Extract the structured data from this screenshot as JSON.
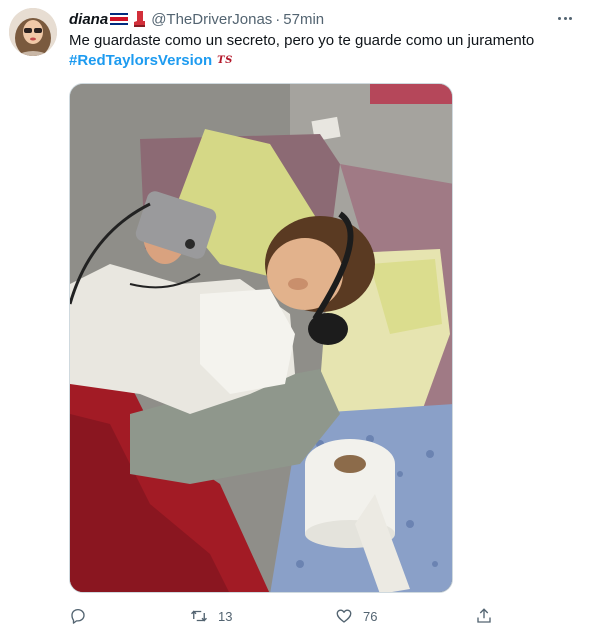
{
  "tweet": {
    "display_name": "diana",
    "handle": "@TheDriverJonas",
    "separator": "·",
    "time": "57min",
    "text": "Me guardaste como un secreto, pero yo te guarde como un juramento",
    "hashtag": "#RedTaylorsVersion",
    "hashtag_emoji_text": "TS"
  },
  "icons": {
    "avatar": "avatar",
    "flag": "costa-rica-flag-icon",
    "boot": "red-boot-icon",
    "more": "more-icon",
    "reply": "reply-icon",
    "retweet": "retweet-icon",
    "like": "heart-icon",
    "share": "share-icon"
  },
  "actions": {
    "reply_count": "",
    "retweet_count": "13",
    "like_count": "76"
  },
  "colors": {
    "accent": "#1d9bf0",
    "text": "#0f1419",
    "muted": "#536471",
    "ts_red": "#b3172a"
  }
}
